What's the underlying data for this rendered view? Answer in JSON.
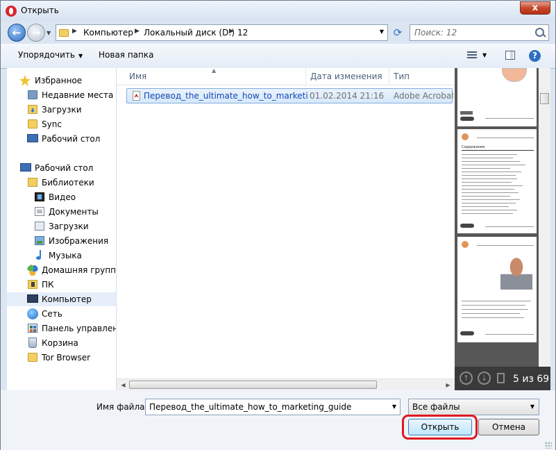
{
  "window": {
    "title": "Открыть",
    "close_label": "x"
  },
  "navigation": {
    "breadcrumb": [
      "Компьютер",
      "Локальный диск (D:)",
      "12"
    ],
    "search_placeholder": "Поиск: 12"
  },
  "toolbar": {
    "organize_label": "Упорядочить",
    "new_folder_label": "Новая папка",
    "help_label": "?"
  },
  "sidebar": {
    "favorites": [
      {
        "label": "Избранное",
        "icon": "star-icon"
      },
      {
        "label": "Недавние места",
        "icon": "recent-places-icon"
      },
      {
        "label": "Загрузки",
        "icon": "downloads-folder-icon"
      },
      {
        "label": "Sync",
        "icon": "folder-icon"
      },
      {
        "label": "Рабочий стол",
        "icon": "desktop-icon"
      }
    ],
    "tree": [
      {
        "label": "Рабочий стол",
        "icon": "desktop-icon"
      },
      {
        "label": "Библиотеки",
        "icon": "library-icon"
      },
      {
        "label": "Видео",
        "icon": "video-library-icon"
      },
      {
        "label": "Документы",
        "icon": "documents-library-icon"
      },
      {
        "label": "Загрузки",
        "icon": "downloads-library-icon"
      },
      {
        "label": "Изображения",
        "icon": "images-library-icon"
      },
      {
        "label": "Музыка",
        "icon": "music-library-icon"
      },
      {
        "label": "Домашняя группа",
        "icon": "homegroup-icon"
      },
      {
        "label": "ПК",
        "icon": "pc-folder-icon"
      },
      {
        "label": "Компьютер",
        "icon": "computer-icon",
        "selected": true
      },
      {
        "label": "Сеть",
        "icon": "network-icon"
      },
      {
        "label": "Панель управления",
        "icon": "control-panel-icon"
      },
      {
        "label": "Корзина",
        "icon": "recycle-bin-icon"
      },
      {
        "label": "Tor Browser",
        "icon": "folder-icon"
      }
    ]
  },
  "file_list": {
    "columns": [
      "Имя",
      "Дата изменения",
      "Тип"
    ],
    "rows": [
      {
        "name": "Перевод_the_ultimate_how_to_marketin...",
        "date": "01.02.2014 21:16",
        "type": "Adobe Acrobat D",
        "icon": "pdf-file-icon",
        "selected": true
      }
    ]
  },
  "preview": {
    "page_indicator": "5 из 69",
    "page_heading": "Содержание"
  },
  "bottom": {
    "filename_label": "Имя файла:",
    "filename_value": "Перевод_the_ultimate_how_to_marketing_guide",
    "filetype_value": "Все файлы",
    "open_label": "Открыть",
    "cancel_label": "Отмена"
  },
  "colors": {
    "highlight_ring": "#e01620",
    "selection_border": "#84acdd",
    "link_text": "#1646b4"
  }
}
